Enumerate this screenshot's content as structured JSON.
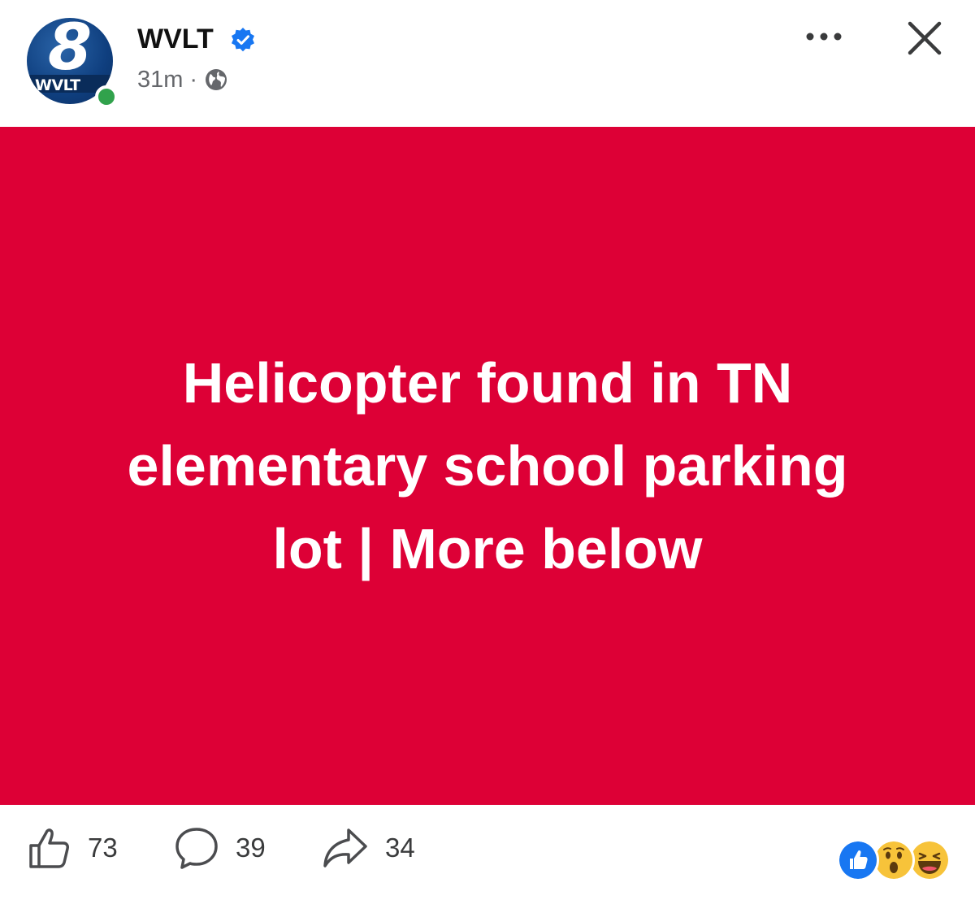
{
  "post": {
    "page_name": "WVLT",
    "avatar_number": "8",
    "avatar_label": "WVLT",
    "time_ago": "31m",
    "separator": "·",
    "audience_icon": "globe-icon",
    "verified_icon": "verified-badge-icon"
  },
  "media": {
    "background_color": "#dd0036",
    "headline_line1": "Helicopter found in TN",
    "headline_line2": "elementary school parking",
    "headline_line3": "lot | More below"
  },
  "actions": {
    "like_count": "73",
    "comment_count": "39",
    "share_count": "34"
  },
  "reactions": [
    "like-reaction-icon",
    "wow-reaction-icon",
    "haha-reaction-icon"
  ],
  "colors": {
    "accent_blue": "#1877f2",
    "online_green": "#31a24c",
    "secondary_text": "#65676b"
  }
}
